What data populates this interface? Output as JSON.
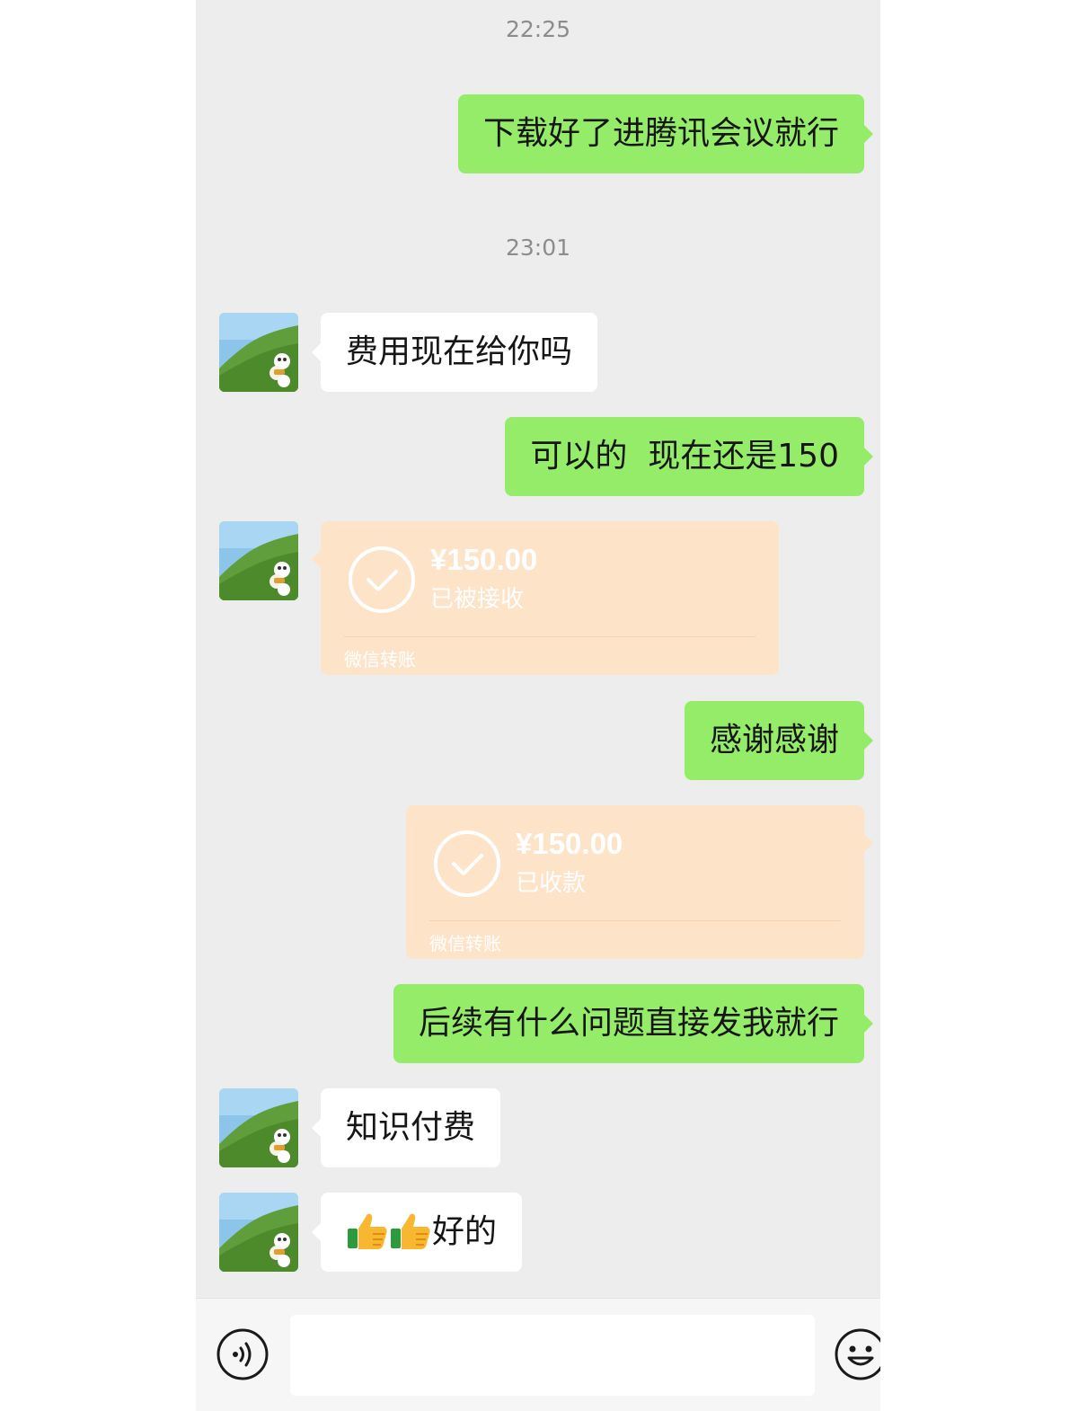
{
  "timestamps": [
    "22:25",
    "23:01"
  ],
  "messages": {
    "m1": "下载好了进腾讯会议就行",
    "m2": "费用现在给你吗",
    "m3": "可以的  现在还是150",
    "m4": "感谢感谢",
    "m5": "后续有什么问题直接发我就行",
    "m6": "知识付费",
    "m7_text": "好的"
  },
  "transfers": {
    "t1": {
      "amount": "¥150.00",
      "status": "已被接收",
      "label": "微信转账"
    },
    "t2": {
      "amount": "¥150.00",
      "status": "已收款",
      "label": "微信转账"
    }
  },
  "input_bar": {
    "value": ""
  },
  "colors": {
    "background": "#ededed",
    "outgoing_bubble": "#95ec69",
    "incoming_bubble": "#ffffff",
    "transfer_card": "#fde4c9"
  },
  "icons": {
    "voice": "voice-mode-icon",
    "emoji": "emoji-face-icon",
    "thumbs": "thumbs-up-icon",
    "check": "check-circle-icon"
  }
}
